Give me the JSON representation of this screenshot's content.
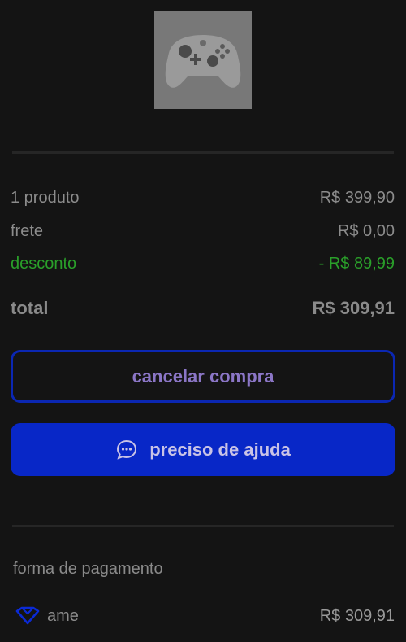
{
  "product": {
    "image_icon": "xbox-controller"
  },
  "summary": {
    "items_label": "1 produto",
    "items_value": "R$ 399,90",
    "shipping_label": "frete",
    "shipping_value": "R$ 0,00",
    "discount_label": "desconto",
    "discount_value": "- R$ 89,99",
    "total_label": "total",
    "total_value": "R$ 309,91"
  },
  "actions": {
    "cancel_label": "cancelar compra",
    "help_label": "preciso de ajuda",
    "help_icon": "chat-bubble-icon"
  },
  "payment": {
    "section_label": "forma de pagamento",
    "method_name": "ame",
    "method_icon": "ame-heart-icon",
    "amount": "R$ 309,91"
  },
  "colors": {
    "background": "#141414",
    "primary_blue": "#0827c7",
    "discount_green": "#2aa02a",
    "cancel_text": "#8b76c6"
  }
}
